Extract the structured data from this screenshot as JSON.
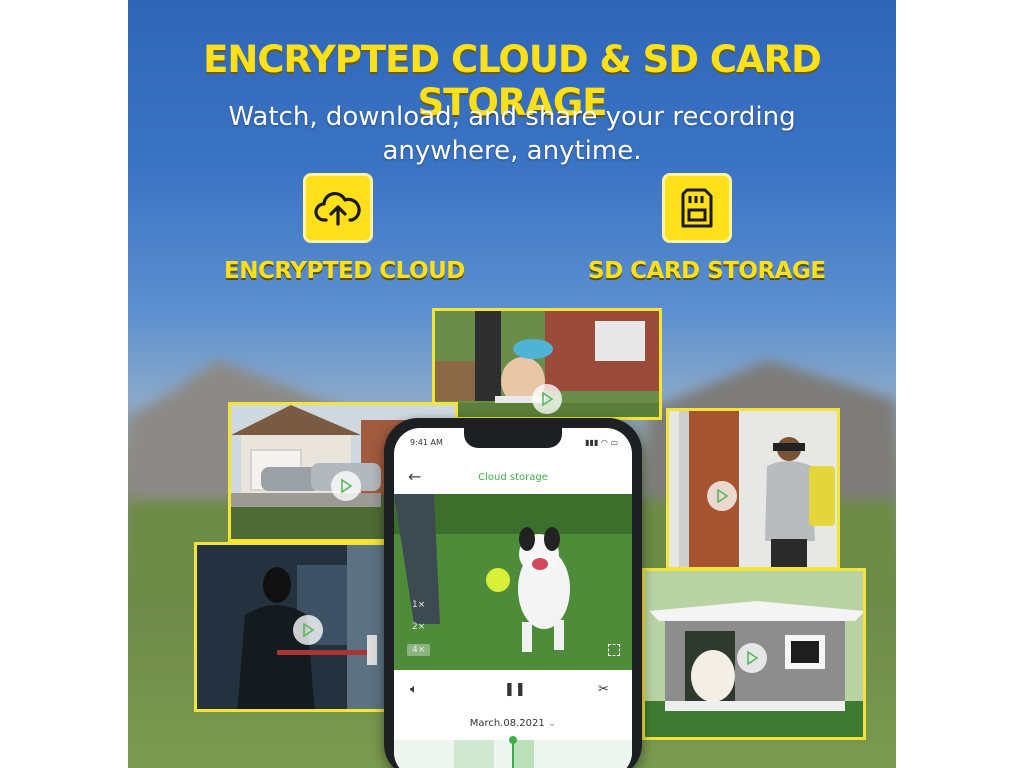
{
  "poster": {
    "title": "ENCRYPTED CLOUD & SD CARD STORAGE",
    "subtitle_line1": "Watch, download, and share your recording",
    "subtitle_line2": "anywhere, anytime.",
    "features": [
      {
        "label": "ENCRYPTED CLOUD",
        "icon": "cloud-upload-icon"
      },
      {
        "label": "SD CARD STORAGE",
        "icon": "sd-card-icon"
      }
    ],
    "accent_color": "#ffe01a"
  },
  "phone": {
    "time": "9:41 AM",
    "app_title": "Cloud storage",
    "speeds": [
      "1×",
      "2×",
      "4×"
    ],
    "selected_speed": "4×",
    "date": "March.08.2021",
    "accent_color": "#3fae49"
  }
}
